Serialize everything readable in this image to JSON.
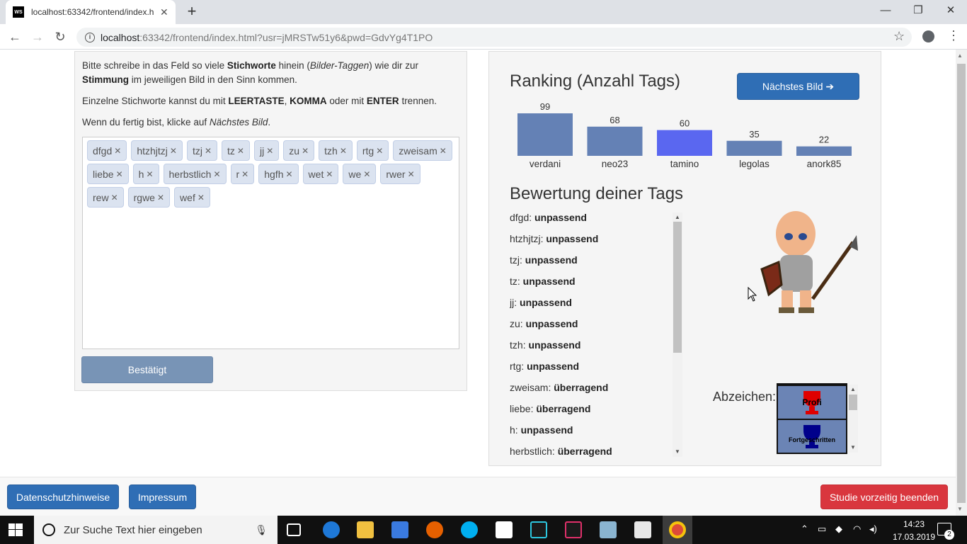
{
  "browser": {
    "tab_title": "localhost:63342/frontend/index.h",
    "tab_favicon": "WS",
    "url_host": "localhost",
    "url_rest": ":63342/frontend/index.html?usr=jMRSTw51y6&pwd=GdvYg4T1PO"
  },
  "left": {
    "instr1_a": "Bitte schreibe in das Feld so viele ",
    "instr1_b": "Stichworte",
    "instr1_c": " hinein (",
    "instr1_d": "Bilder-Taggen",
    "instr1_e": ") wie dir zur",
    "instr2_a": "Stimmung",
    "instr2_b": " im jeweiligen Bild in den Sinn kommen.",
    "instr3_a": "Einzelne Stichworte kannst du mit ",
    "instr3_b": "LEERTASTE",
    "instr3_c": ", ",
    "instr3_d": "KOMMA",
    "instr3_e": " oder mit ",
    "instr3_f": "ENTER",
    "instr3_g": " trennen.",
    "instr4_a": "Wenn du fertig bist, klicke auf ",
    "instr4_b": "Nächstes Bild",
    "instr4_c": ".",
    "tags": [
      "dfgd",
      "htzhjtzj",
      "tzj",
      "tz",
      "jj",
      "zu",
      "tzh",
      "rtg",
      "zweisam",
      "liebe",
      "h",
      "herbstlich",
      "r",
      "hgfh",
      "wet",
      "we",
      "rwer",
      "rew",
      "rgwe",
      "wef"
    ],
    "confirm_label": "Bestätigt"
  },
  "right": {
    "ranking_title": "Ranking (Anzahl Tags)",
    "next_label": "Nächstes Bild ➔",
    "rating_title": "Bewertung deiner Tags",
    "ratings": [
      {
        "tag": "dfgd",
        "verdict": "unpassend"
      },
      {
        "tag": "htzhjtzj",
        "verdict": "unpassend"
      },
      {
        "tag": "tzj",
        "verdict": "unpassend"
      },
      {
        "tag": "tz",
        "verdict": "unpassend"
      },
      {
        "tag": "jj",
        "verdict": "unpassend"
      },
      {
        "tag": "zu",
        "verdict": "unpassend"
      },
      {
        "tag": "tzh",
        "verdict": "unpassend"
      },
      {
        "tag": "rtg",
        "verdict": "unpassend"
      },
      {
        "tag": "zweisam",
        "verdict": "überragend"
      },
      {
        "tag": "liebe",
        "verdict": "überragend"
      },
      {
        "tag": "h",
        "verdict": "unpassend"
      },
      {
        "tag": "herbstlich",
        "verdict": "überragend"
      }
    ],
    "badges_label": "Abzeichen:",
    "badges": [
      {
        "name": "Profi",
        "color": "#e00000"
      },
      {
        "name": "Fortgeschritten",
        "color": "#00008b"
      }
    ]
  },
  "chart_data": {
    "type": "bar",
    "categories": [
      "verdani",
      "neo23",
      "tamino",
      "legolas",
      "anork85"
    ],
    "values": [
      99,
      68,
      60,
      35,
      22
    ],
    "highlight": "tamino",
    "colors": {
      "bar": "#6481b5",
      "highlight": "#5a67f0"
    }
  },
  "footer": {
    "privacy_label": "Datenschutzhinweise",
    "imprint_label": "Impressum",
    "quit_label": "Studie vorzeitig beenden"
  },
  "taskbar": {
    "search_placeholder": "Zur Suche Text hier eingeben",
    "time": "14:23",
    "date": "17.03.2019",
    "notifications": "2"
  },
  "colors": {
    "primary": "#2f6eb5",
    "danger": "#d9363e",
    "chip_bg": "#dbe3f0"
  }
}
